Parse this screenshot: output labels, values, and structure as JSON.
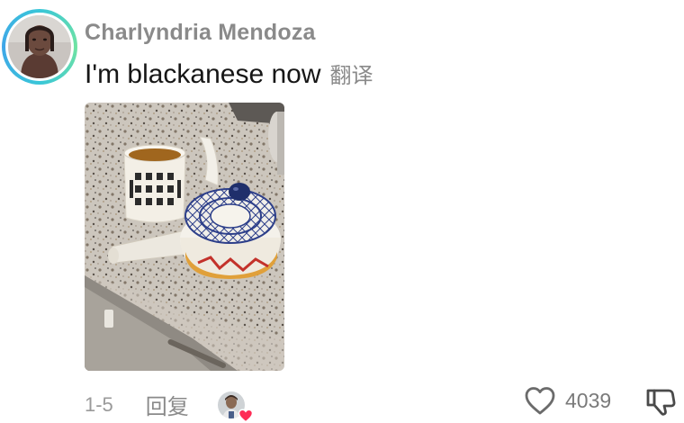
{
  "comment": {
    "username": "Charlyndria Mendoza",
    "text": "I'm blackanese now",
    "translate_label": "翻译",
    "timestamp": "1-5",
    "reply_label": "回复",
    "like_count": "4039",
    "liked_by_creator": true
  },
  "icons": {
    "like": "heart-outline-icon",
    "dislike": "thumbs-down-icon",
    "creator_like_badge": "heart-icon"
  },
  "colors": {
    "avatar_ring": "#39c6d8",
    "username": "#8a8a8a",
    "comment_text": "#161616",
    "creator_heart": "#fe2c55"
  }
}
